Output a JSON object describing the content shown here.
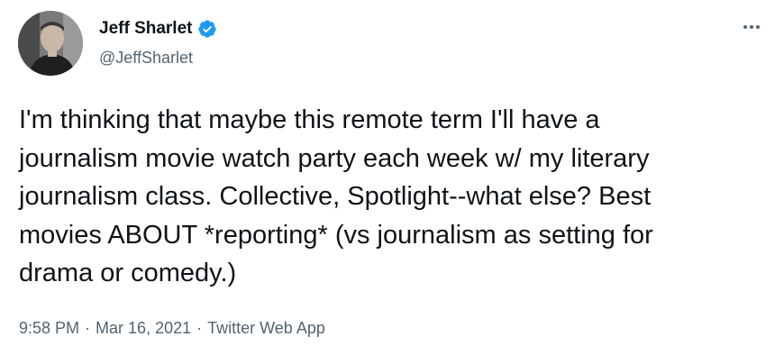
{
  "author": {
    "display_name": "Jeff Sharlet",
    "handle": "@JeffSharlet",
    "verified": true,
    "verified_badge_icon": "verified-badge-icon"
  },
  "tweet": {
    "lines": [
      "I'm thinking that maybe this remote term I'll have a",
      "journalism movie watch party each week w/ my literary",
      "journalism class. Collective, Spotlight--what else? Best",
      "movies ABOUT *reporting* (vs journalism as setting for",
      "drama or comedy.)"
    ]
  },
  "meta": {
    "time": "9:58 PM",
    "separator": "·",
    "date": "Mar 16, 2021",
    "source": "Twitter Web App"
  },
  "menu": {
    "icon": "more-options-icon"
  },
  "colors": {
    "text": "#0f1419",
    "secondary": "#536471",
    "verified_blue": "#1d9bf0"
  }
}
